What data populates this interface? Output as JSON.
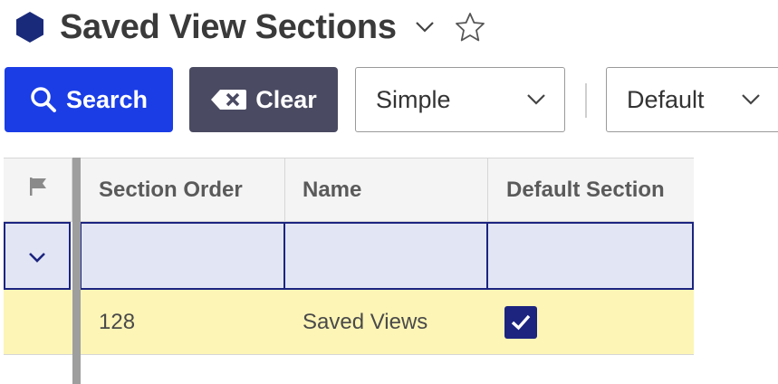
{
  "header": {
    "title": "Saved View Sections",
    "icon": "hexagon-icon",
    "accent_color": "#1a2a7a"
  },
  "toolbar": {
    "search_label": "Search",
    "clear_label": "Clear",
    "mode_select": {
      "value": "Simple"
    },
    "view_select": {
      "value": "Default"
    },
    "colors": {
      "search": "#1a3de6",
      "clear": "#4a4a62"
    }
  },
  "table": {
    "columns": [
      "Section Order",
      "Name",
      "Default Section"
    ],
    "rows": [
      {
        "section_order": "128",
        "name": "Saved Views",
        "default_section": true
      }
    ],
    "colors": {
      "filter_row": "#e2e6f4",
      "selected_row": "#fdf5b6",
      "checkbox": "#1c2480"
    }
  }
}
